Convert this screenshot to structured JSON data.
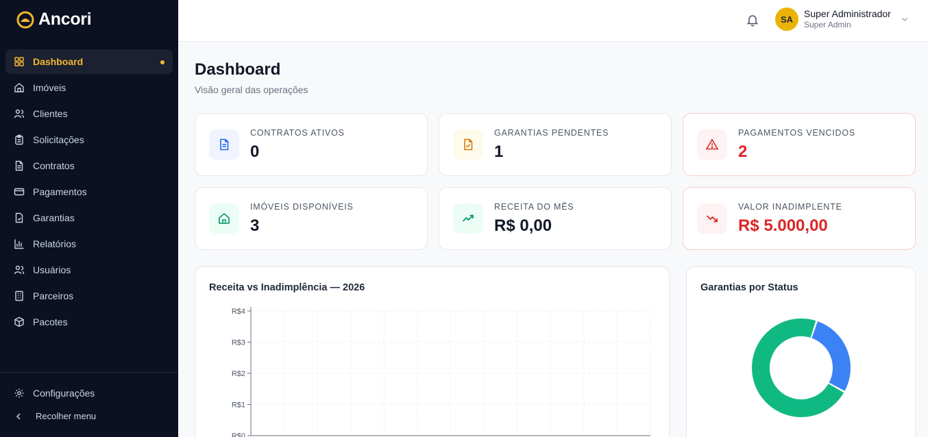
{
  "brand": {
    "name": "Ancori"
  },
  "sidebar": {
    "items": [
      {
        "label": "Dashboard",
        "icon": "grid-icon",
        "active": true
      },
      {
        "label": "Imóveis",
        "icon": "home-icon"
      },
      {
        "label": "Clientes",
        "icon": "users-icon"
      },
      {
        "label": "Solicitações",
        "icon": "clipboard-icon"
      },
      {
        "label": "Contratos",
        "icon": "document-icon"
      },
      {
        "label": "Pagamentos",
        "icon": "credit-card-icon"
      },
      {
        "label": "Garantias",
        "icon": "file-check-icon"
      },
      {
        "label": "Relatórios",
        "icon": "bar-chart-icon"
      },
      {
        "label": "Usuários",
        "icon": "users-icon"
      },
      {
        "label": "Parceiros",
        "icon": "building-icon"
      },
      {
        "label": "Pacotes",
        "icon": "box-icon"
      }
    ],
    "settings_label": "Configurações",
    "collapse_label": "Recolher menu"
  },
  "header": {
    "user_initials": "SA",
    "user_name": "Super Administrador",
    "user_role": "Super Admin"
  },
  "page": {
    "title": "Dashboard",
    "subtitle": "Visão geral das operações"
  },
  "stats": [
    {
      "label": "CONTRATOS ATIVOS",
      "value": "0",
      "icon": "document-icon",
      "tone": "blue"
    },
    {
      "label": "GARANTIAS PENDENTES",
      "value": "1",
      "icon": "file-check-icon",
      "tone": "amber"
    },
    {
      "label": "PAGAMENTOS VENCIDOS",
      "value": "2",
      "icon": "alert-triangle-icon",
      "tone": "red"
    },
    {
      "label": "IMÓVEIS DISPONÍVEIS",
      "value": "3",
      "icon": "home-icon",
      "tone": "green"
    },
    {
      "label": "RECEITA DO MÊS",
      "value": "R$ 0,00",
      "icon": "trending-up-icon",
      "tone": "green"
    },
    {
      "label": "VALOR INADIMPLENTE",
      "value": "R$ 5.000,00",
      "icon": "trending-down-icon",
      "tone": "red"
    }
  ],
  "colors": {
    "accent": "#f5b82e",
    "danger": "#dc2626",
    "donut_blue": "#3b82f6",
    "donut_green": "#10b981"
  },
  "chart_data": [
    {
      "type": "line",
      "title": "Receita vs Inadimplência — 2026",
      "ylim": [
        0,
        4
      ],
      "yticks": [
        "R$0",
        "R$1",
        "R$2",
        "R$3",
        "R$4"
      ],
      "grid": true
    },
    {
      "type": "pie",
      "title": "Garantias por Status",
      "slices": [
        {
          "value": 28,
          "color": "#3b82f6"
        },
        {
          "value": 72,
          "color": "#10b981"
        }
      ]
    }
  ]
}
